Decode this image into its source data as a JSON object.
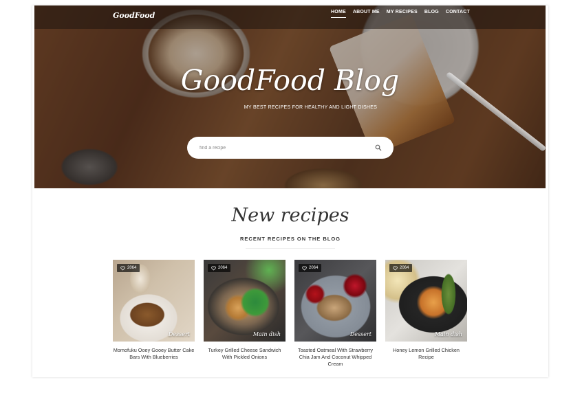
{
  "brand": {
    "logo": "GoodFood"
  },
  "nav": {
    "items": [
      "HOME",
      "ABOUT ME",
      "MY RECIPES",
      "BLOG",
      "CONTACT"
    ],
    "active": "HOME"
  },
  "hero": {
    "title": "GoodFood Blog",
    "subtitle": "MY BEST RECIPES FOR HEALTHY AND LIGHT DISHES",
    "search_placeholder": "find a recipe"
  },
  "section": {
    "title": "New recipes",
    "subtitle": "RECENT RECIPES ON THE BLOG"
  },
  "recipes": [
    {
      "likes": "2064",
      "category": "Dessert",
      "title": "Momofuku Ooey Gooey Butter Cake Bars With Blueberries"
    },
    {
      "likes": "2064",
      "category": "Main dish",
      "title": "Turkey Grilled Cheese Sandwich With Pickled Onions"
    },
    {
      "likes": "2064",
      "category": "Dessert",
      "title": "Toasted Oatmeal With Strawberry Chia Jam And Coconut Whipped Cream"
    },
    {
      "likes": "2064",
      "category": "Main dish",
      "title": "Honey Lemon Grilled Chicken Recipe"
    }
  ],
  "icons": {
    "search": "search-icon",
    "like": "heart-icon"
  }
}
